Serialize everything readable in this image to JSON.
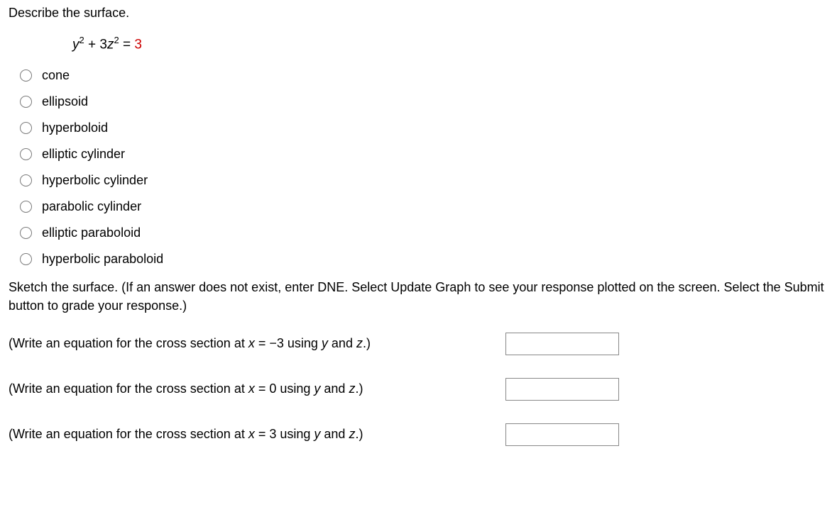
{
  "prompt": "Describe the surface.",
  "equation_html": "<span class='term'>y</span><sup>2</sup> + 3<span class='term'>z</span><sup>2</sup> = <span class='red'>3</span>",
  "options": [
    {
      "label": "cone"
    },
    {
      "label": "ellipsoid"
    },
    {
      "label": "hyperboloid"
    },
    {
      "label": "elliptic cylinder"
    },
    {
      "label": "hyperbolic cylinder"
    },
    {
      "label": "parabolic cylinder"
    },
    {
      "label": "elliptic paraboloid"
    },
    {
      "label": "hyperbolic paraboloid"
    }
  ],
  "instruction": "Sketch the surface. (If an answer does not exist, enter DNE. Select Update Graph to see your response plotted on the screen. Select the Submit button to grade your response.)",
  "cross_sections": [
    {
      "pre": "(Write an equation for the cross section at ",
      "var": "x",
      "eq": " = −3 using ",
      "v1": "y",
      "and": " and ",
      "v2": "z",
      "post": ".)"
    },
    {
      "pre": "(Write an equation for the cross section at ",
      "var": "x",
      "eq": " = 0 using ",
      "v1": "y",
      "and": " and ",
      "v2": "z",
      "post": ".)"
    },
    {
      "pre": "(Write an equation for the cross section at ",
      "var": "x",
      "eq": " = 3 using ",
      "v1": "y",
      "and": " and ",
      "v2": "z",
      "post": ".)"
    }
  ]
}
